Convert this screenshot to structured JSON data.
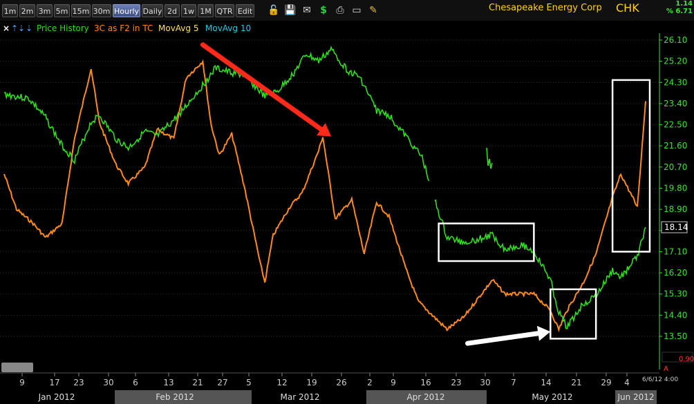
{
  "toolbar": {
    "timeframes": [
      "1m",
      "2m",
      "3m",
      "5m",
      "15m",
      "30m",
      "Hourly",
      "Daily",
      "2d",
      "1w",
      "1M",
      "QTR",
      "Edit"
    ],
    "active": "Hourly",
    "icons": [
      "lock-icon",
      "save-icon",
      "mail-icon",
      "dollar-icon",
      "print-icon",
      "alert-icon",
      "pencil-icon"
    ]
  },
  "header": {
    "company": "Chesapeake Energy Corp",
    "ticker": "CHK",
    "change": "1.14",
    "change_pct": "% 6.71"
  },
  "legend": {
    "close": "×",
    "up": "⇡",
    "down": "⇣",
    "price": "Price History",
    "indicator": "3C as F2 in TC",
    "ma5": "MovAvg 5",
    "ma10": "MovAvg 10"
  },
  "colors": {
    "price": "#33dd22",
    "indicator": "#ff8a1e",
    "ma5": "#ffe066",
    "ma10": "#2ec8e8",
    "arrow_red": "#ff2a1a",
    "axis_green": "#3ce333"
  },
  "price_box": "18.14",
  "indicator_box": "",
  "date_label": "6/6/12 4:00",
  "indicator_scale_label": "0.90",
  "alert_label": "A",
  "chart_data": {
    "type": "line",
    "ylim": [
      13.5,
      26.1
    ],
    "yticks": [
      26.1,
      25.2,
      24.3,
      23.4,
      22.5,
      21.6,
      20.7,
      19.8,
      18.9,
      18.0,
      17.1,
      16.2,
      15.3,
      14.4,
      13.5
    ],
    "ytick_labels": [
      "26.10",
      "25.20",
      "24.30",
      "23.40",
      "22.50",
      "21.60",
      "20.70",
      "19.80",
      "18.90",
      "",
      "17.10",
      "16.20",
      "15.30",
      "14.40",
      "13.50"
    ],
    "xtick_labels": [
      "9",
      "17",
      "23",
      "30",
      "6",
      "13",
      "21",
      "27",
      "5",
      "12",
      "19",
      "26",
      "2",
      "9",
      "16",
      "23",
      "30",
      "7",
      "14",
      "21",
      "29",
      "4"
    ],
    "months": [
      "Jan 2012",
      "Feb 2012",
      "Mar 2012",
      "Apr 2012",
      "May 2012",
      "Jun 2012"
    ],
    "series": [
      {
        "name": "Price History",
        "x": [
          "2012-01-03",
          "2012-01-09",
          "2012-01-13",
          "2012-01-17",
          "2012-01-20",
          "2012-01-24",
          "2012-01-26",
          "2012-01-30",
          "2012-02-02",
          "2012-02-06",
          "2012-02-09",
          "2012-02-13",
          "2012-02-16",
          "2012-02-21",
          "2012-02-23",
          "2012-02-27",
          "2012-03-01",
          "2012-03-06",
          "2012-03-09",
          "2012-03-13",
          "2012-03-16",
          "2012-03-19",
          "2012-03-22",
          "2012-03-26",
          "2012-03-29",
          "2012-04-02",
          "2012-04-05",
          "2012-04-10",
          "2012-04-13",
          "2012-04-16",
          "2012-04-19",
          "2012-04-23",
          "2012-04-26",
          "2012-04-30",
          "2012-05-03",
          "2012-05-07",
          "2012-05-10",
          "2012-05-14",
          "2012-05-16",
          "2012-05-18",
          "2012-05-22",
          "2012-05-25",
          "2012-05-29",
          "2012-05-31",
          "2012-06-04",
          "2012-06-06"
        ],
        "values": [
          23.8,
          23.6,
          22.8,
          21.6,
          21.0,
          22.6,
          22.9,
          21.9,
          21.5,
          22.2,
          22.0,
          22.7,
          23.3,
          24.4,
          24.9,
          24.7,
          24.6,
          23.7,
          23.9,
          24.7,
          25.5,
          25.2,
          25.7,
          24.8,
          24.5,
          23.1,
          22.9,
          21.8,
          21.1,
          19.3,
          17.7,
          17.5,
          17.6,
          17.8,
          17.2,
          17.4,
          17.1,
          15.9,
          14.5,
          13.9,
          14.9,
          15.2,
          16.3,
          16.0,
          16.9,
          18.14
        ]
      },
      {
        "name": "3C as F2 in TC",
        "x": [
          "2012-01-03",
          "2012-01-06",
          "2012-01-10",
          "2012-01-13",
          "2012-01-17",
          "2012-01-20",
          "2012-01-24",
          "2012-01-26",
          "2012-01-30",
          "2012-02-02",
          "2012-02-06",
          "2012-02-09",
          "2012-02-13",
          "2012-02-16",
          "2012-02-20",
          "2012-02-22",
          "2012-02-24",
          "2012-02-27",
          "2012-03-01",
          "2012-03-05",
          "2012-03-06",
          "2012-03-08",
          "2012-03-12",
          "2012-03-15",
          "2012-03-19",
          "2012-03-20",
          "2012-03-23",
          "2012-03-27",
          "2012-03-30",
          "2012-04-02",
          "2012-04-05",
          "2012-04-09",
          "2012-04-12",
          "2012-04-16",
          "2012-04-19",
          "2012-04-23",
          "2012-04-26",
          "2012-04-30",
          "2012-05-03",
          "2012-05-07",
          "2012-05-10",
          "2012-05-14",
          "2012-05-16",
          "2012-05-18",
          "2012-05-22",
          "2012-05-25",
          "2012-05-29",
          "2012-05-31",
          "2012-06-04",
          "2012-06-06"
        ],
        "values": [
          20.4,
          18.9,
          18.3,
          17.7,
          18.3,
          21.9,
          24.9,
          22.6,
          20.8,
          20.0,
          20.7,
          22.3,
          21.9,
          24.5,
          25.2,
          22.5,
          21.2,
          22.1,
          19.9,
          16.5,
          15.8,
          17.8,
          19.0,
          19.6,
          21.4,
          22.0,
          18.5,
          19.3,
          17.0,
          19.2,
          18.6,
          16.4,
          15.0,
          14.3,
          13.8,
          14.3,
          15.0,
          15.9,
          15.3,
          15.3,
          15.3,
          14.6,
          13.8,
          14.6,
          15.8,
          17.0,
          19.4,
          20.4,
          19.0,
          23.5
        ]
      },
      {
        "name": "MovAvg 5",
        "x": [],
        "values": []
      },
      {
        "name": "MovAvg 10",
        "x": [],
        "values": []
      }
    ],
    "annotations": [
      {
        "type": "arrow",
        "color": "red",
        "from": [
          "2012-02-20",
          25.9
        ],
        "to": [
          "2012-03-22",
          22.0
        ]
      },
      {
        "type": "arrow",
        "color": "white",
        "from": [
          "2012-04-24",
          13.2
        ],
        "to": [
          "2012-05-14",
          13.7
        ]
      },
      {
        "type": "box",
        "from": [
          "2012-04-17",
          16.7
        ],
        "to": [
          "2012-05-10",
          18.3
        ]
      },
      {
        "type": "box",
        "from": [
          "2012-05-14",
          13.4
        ],
        "to": [
          "2012-05-25",
          15.5
        ]
      },
      {
        "type": "box",
        "from": [
          "2012-05-29",
          17.1
        ],
        "to": [
          "2012-06-07",
          24.4
        ]
      }
    ]
  }
}
